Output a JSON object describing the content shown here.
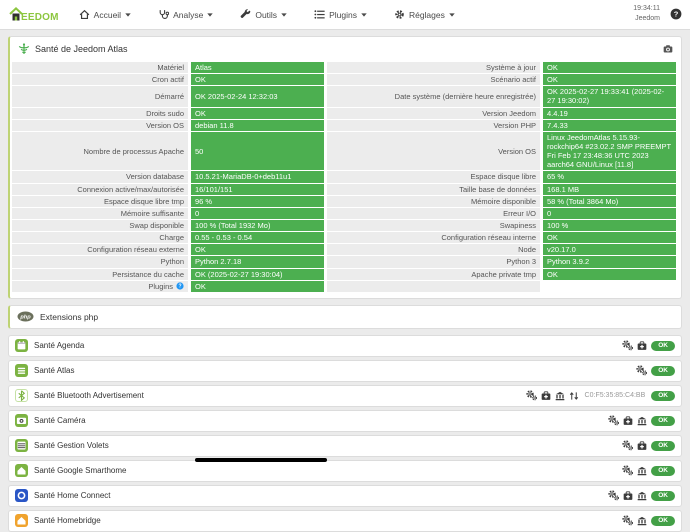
{
  "navbar": {
    "brand": "EEDOM",
    "items": [
      {
        "label": "Accueil",
        "icon": "home"
      },
      {
        "label": "Analyse",
        "icon": "stethoscope"
      },
      {
        "label": "Outils",
        "icon": "wrench"
      },
      {
        "label": "Plugins",
        "icon": "list"
      },
      {
        "label": "Réglages",
        "icon": "gear"
      }
    ],
    "clock": "19:34:11",
    "user": "Jeedom",
    "help_icon": "question-icon"
  },
  "health": {
    "title": "Santé de Jeedom Atlas",
    "title_icon": "caduceus-icon",
    "corner_icon": "camera-icon",
    "rows": [
      {
        "l": "Matériel",
        "lv": "Atlas",
        "r": "Système à jour",
        "rv": "OK"
      },
      {
        "l": "Cron actif",
        "lv": "OK",
        "r": "Scénario actif",
        "rv": "OK"
      },
      {
        "l": "Démarré",
        "lv": "OK 2025-02-24 12:32:03",
        "r": "Date système (dernière heure enregistrée)",
        "rv": "OK 2025-02-27 19:33:41 (2025-02-27 19:30:02)"
      },
      {
        "l": "Droits sudo",
        "lv": "OK",
        "r": "Version Jeedom",
        "rv": "4.4.19"
      },
      {
        "l": "Version OS",
        "lv": "debian 11.8",
        "r": "Version PHP",
        "rv": "7.4.33"
      },
      {
        "l": "Nombre de processus Apache",
        "lv": "50",
        "r": "Version OS",
        "rv": "Linux JeedomAtlas 5.15.93-rockchip64 #23.02.2 SMP PREEMPT Fri Feb 17 23:48:36 UTC 2023 aarch64 GNU/Linux [11.8]"
      },
      {
        "l": "Version database",
        "lv": "10.5.21-MariaDB-0+deb11u1",
        "r": "Espace disque libre",
        "rv": "65 %"
      },
      {
        "l": "Connexion active/max/autorisée",
        "lv": "16/101/151",
        "r": "Taille base de données",
        "rv": "168.1 MB"
      },
      {
        "l": "Espace disque libre tmp",
        "lv": "96 %",
        "r": "Mémoire disponible",
        "rv": "58 % (Total 3864 Mo)"
      },
      {
        "l": "Mémoire suffisante",
        "lv": "0",
        "r": "Erreur I/O",
        "rv": "0"
      },
      {
        "l": "Swap disponible",
        "lv": "100 % (Total 1932 Mo)",
        "r": "Swapiness",
        "rv": "100 %"
      },
      {
        "l": "Charge",
        "lv": "0.55 - 0.53 - 0.54",
        "r": "Configuration réseau interne",
        "rv": "OK"
      },
      {
        "l": "Configuration réseau externe",
        "lv": "OK",
        "r": "Node",
        "rv": "v20.17.0"
      },
      {
        "l": "Python",
        "lv": "Python 2.7.18",
        "r": "Python 3",
        "rv": "Python 3.9.2"
      },
      {
        "l": "Persistance du cache",
        "lv": "OK (2025-02-27 19:30:04)",
        "r": "Apache private tmp",
        "rv": "OK"
      },
      {
        "l": "Plugins",
        "l_help": true,
        "lv": "OK",
        "r": "",
        "rv": "",
        "r_empty": true
      }
    ]
  },
  "extensions": {
    "title": "Extensions php",
    "icon": "php-icon"
  },
  "plugins": [
    {
      "name": "Santé Agenda",
      "icon": "calendar",
      "icon_bg": "#7cb342",
      "actions": [
        "cogs",
        "medkit"
      ],
      "status": "OK"
    },
    {
      "name": "Santé Atlas",
      "icon": "lines",
      "icon_bg": "#7cb342",
      "actions": [
        "cogs"
      ],
      "status": "OK"
    },
    {
      "name": "Santé Bluetooth Advertisement",
      "icon": "bluetooth",
      "icon_bg": "#ffffff",
      "actions": [
        "cogs",
        "medkit",
        "bank",
        "sort"
      ],
      "meta": "C0:F5:35:85:C4:BB",
      "status": "OK"
    },
    {
      "name": "Santé Caméra",
      "icon": "camera-plugin",
      "icon_bg": "#7cb342",
      "actions": [
        "cogs",
        "medkit",
        "bank"
      ],
      "status": "OK"
    },
    {
      "name": "Santé Gestion Volets",
      "icon": "shutter",
      "icon_bg": "#7cb342",
      "actions": [
        "cogs",
        "medkit"
      ],
      "status": "OK"
    },
    {
      "name": "Santé Google Smarthome",
      "icon": "house",
      "icon_bg": "#7cb342",
      "actions": [
        "cogs",
        "bank"
      ],
      "status": "OK"
    },
    {
      "name": "Santé Home Connect",
      "icon": "ring",
      "icon_bg": "#2a56c6",
      "actions": [
        "cogs",
        "medkit",
        "bank"
      ],
      "status": "OK"
    },
    {
      "name": "Santé Homebridge",
      "icon": "house",
      "icon_bg": "#f0a32e",
      "actions": [
        "cogs",
        "bank"
      ],
      "status": "OK"
    }
  ],
  "colors": {
    "brand_green": "#8cc63f",
    "value_green": "#4caf50",
    "badge_green": "#43a047",
    "label_bg": "#ececec",
    "panel_border_accent": "#bed374",
    "icon_dark": "#3c3c3c"
  }
}
